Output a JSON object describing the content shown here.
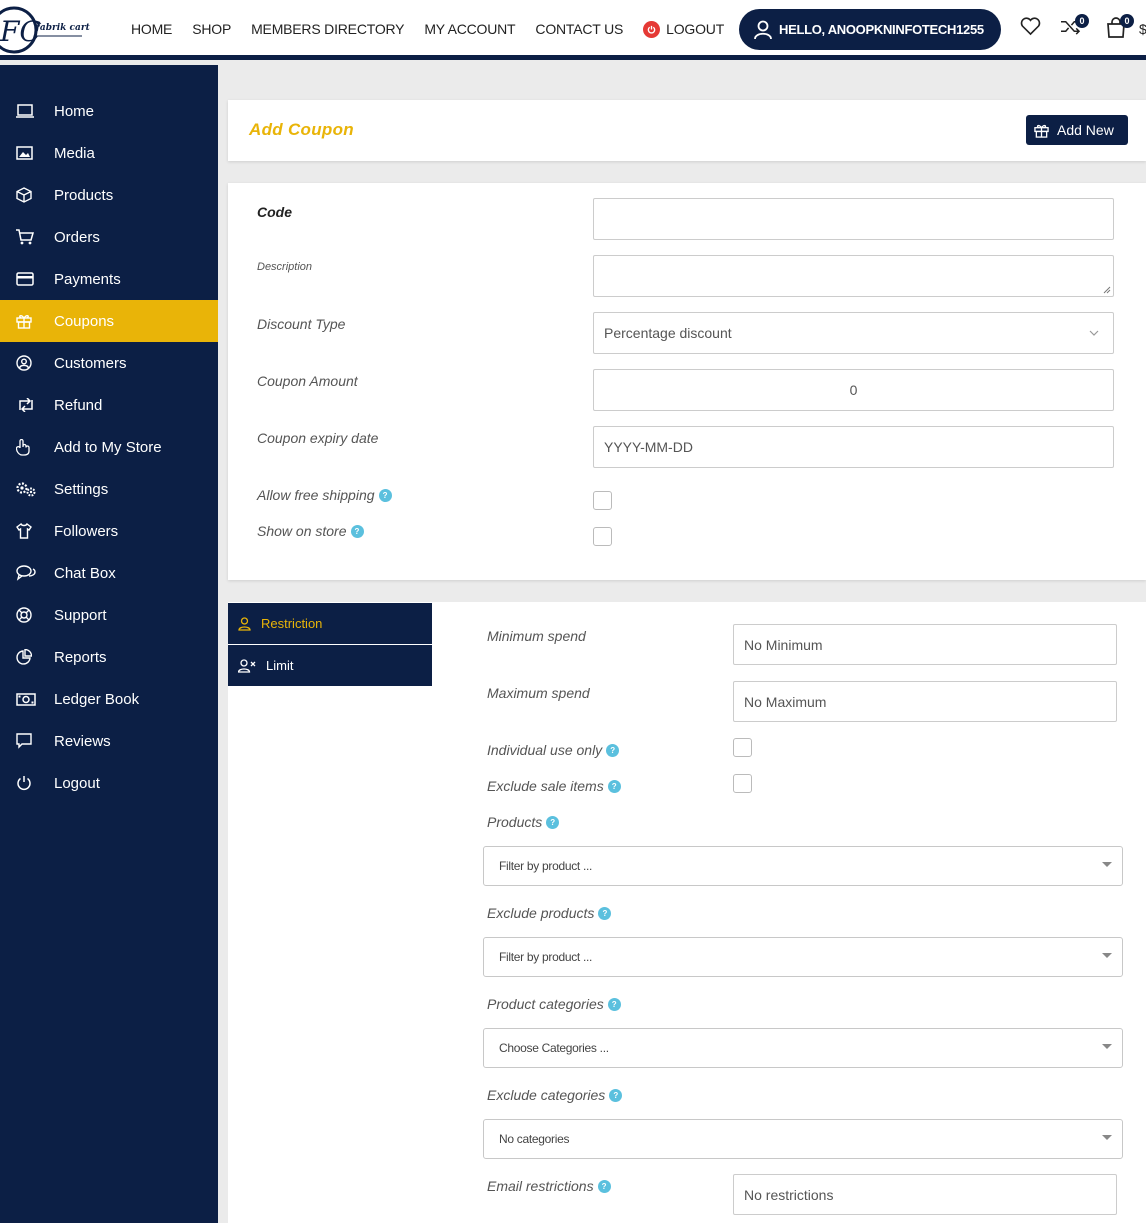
{
  "header": {
    "nav": [
      "HOME",
      "SHOP",
      "MEMBERS DIRECTORY",
      "MY ACCOUNT",
      "CONTACT US"
    ],
    "logout": "LOGOUT",
    "hello": "HELLO, ANOOPKNINFOTECH1255",
    "compare_count": "0",
    "cart_count": "0",
    "cut_symbol": "$",
    "logo_text": "fabrik cart",
    "logo_initials": "FC"
  },
  "sidebar": {
    "items": [
      "Home",
      "Media",
      "Products",
      "Orders",
      "Payments",
      "Coupons",
      "Customers",
      "Refund",
      "Add to My Store",
      "Settings",
      "Followers",
      "Chat Box",
      "Support",
      "Reports",
      "Ledger Book",
      "Reviews",
      "Logout"
    ],
    "active_index": 5
  },
  "page": {
    "title": "Add Coupon",
    "add_new": "Add New"
  },
  "form": {
    "code_label": "Code",
    "code_value": "",
    "description_label": "Description",
    "description_value": "",
    "discount_type_label": "Discount Type",
    "discount_type_value": "Percentage discount",
    "amount_label": "Coupon Amount",
    "amount_value": "0",
    "expiry_label": "Coupon expiry date",
    "expiry_placeholder": "YYYY-MM-DD",
    "free_shipping_label": "Allow free shipping",
    "show_on_store_label": "Show on store"
  },
  "tabs": [
    "Restriction",
    "Limit"
  ],
  "restriction": {
    "min_spend_label": "Minimum spend",
    "min_spend_placeholder": "No Minimum",
    "max_spend_label": "Maximum spend",
    "max_spend_placeholder": "No Maximum",
    "individual_label": "Individual use only",
    "exclude_sale_label": "Exclude sale items",
    "products_label": "Products",
    "products_placeholder": "Filter by product ...",
    "exclude_products_label": "Exclude products",
    "exclude_products_placeholder": "Filter by product ...",
    "categories_label": "Product categories",
    "categories_placeholder": "Choose Categories ...",
    "exclude_categories_label": "Exclude categories",
    "exclude_categories_placeholder": "No categories",
    "email_label": "Email restrictions",
    "email_placeholder": "No restrictions"
  },
  "colors": {
    "navy": "#0c1f45",
    "accent": "#e9b408",
    "help": "#5bc0de"
  }
}
